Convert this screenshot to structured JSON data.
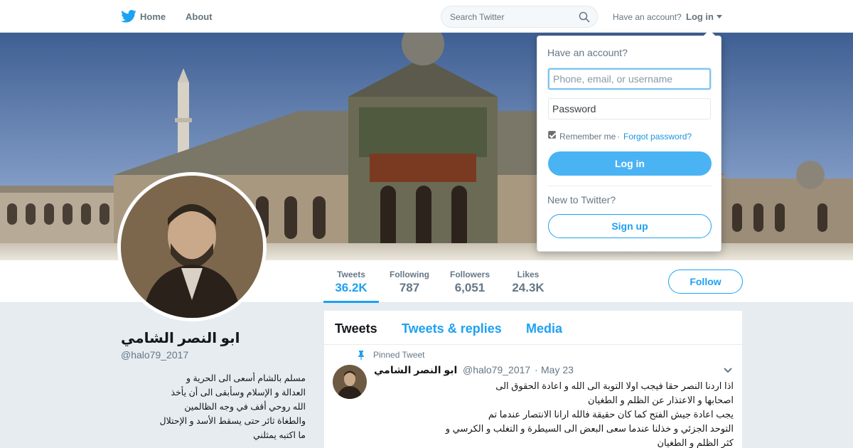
{
  "nav": {
    "home_label": "Home",
    "about_label": "About",
    "search_placeholder": "Search Twitter",
    "have_account": "Have an account?",
    "login_label": "Log in",
    "bird_icon": "twitter-bird-icon",
    "search_icon": "search-icon"
  },
  "profile": {
    "name": "ابو النصر الشامي",
    "handle": "@halo79_2017",
    "bio": "مسلم بالشام أسعى الى الحرية و\nالعدالة و الإسلام وسأبقى الى أن يأخذ\nالله روحي أقف في وجه الظالمين\nوالطغاة ثائر حتى يسقط الأسد و الإحتلال\nما اكتبه يمثلني",
    "follow_label": "Follow"
  },
  "stats": [
    {
      "label": "Tweets",
      "value": "36.2K"
    },
    {
      "label": "Following",
      "value": "787"
    },
    {
      "label": "Followers",
      "value": "6,051"
    },
    {
      "label": "Likes",
      "value": "24.3K"
    }
  ],
  "timeline": {
    "tabs": [
      "Tweets",
      "Tweets & replies",
      "Media"
    ],
    "pinned_label": "Pinned Tweet",
    "tweet": {
      "name": "ابو النصر الشامي",
      "handle": "@halo79_2017",
      "separator": "·",
      "date": "May 23",
      "text": "اذا اردنا النصر حقا فيجب اولا التوبة الى الله و اعادة الحقوق الى\nاصحابها و الاعتذار عن الظلم و الطغيان\nيجب اعادة جيش الفتح كما كان حقيقة فالله ارانا الانتصار عندما تم\nالتوحد الجزئي و خذلنا عندما سعى البعض الى السيطرة و التغلب و الكرسي و\nكثر الظلم و الطغيان"
    }
  },
  "login_dropdown": {
    "title": "Have an account?",
    "username_placeholder": "Phone, email, or username",
    "password_placeholder": "Password",
    "remember_label": "Remember me",
    "separator": "·",
    "forgot_label": "Forgot password?",
    "login_button": "Log in",
    "new_label": "New to Twitter?",
    "signup_button": "Sign up",
    "remember_checked": true
  },
  "colors": {
    "accent": "#1da1f2",
    "login_button": "#4ab3f4",
    "background": "#e6ecf0",
    "muted_text": "#657786"
  }
}
